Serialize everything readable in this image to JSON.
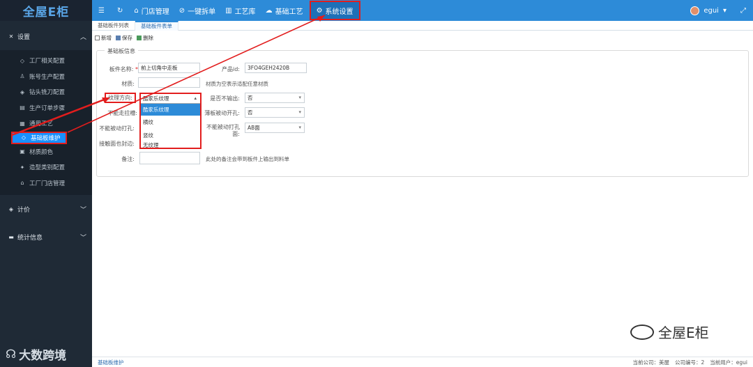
{
  "app": {
    "logo": "全屋E柜"
  },
  "topbar": {
    "menu_icon": "menu-icon",
    "refresh_icon": "refresh-icon",
    "nav": [
      "门店管理",
      "一键拆单",
      "工艺库",
      "基础工艺",
      "系统设置"
    ],
    "user": "egui"
  },
  "sidebar": {
    "groups": [
      {
        "label": "设置",
        "expanded": true
      },
      {
        "label": "计价",
        "expanded": false
      },
      {
        "label": "统计信息",
        "expanded": false
      }
    ],
    "items": [
      "工厂相关配置",
      "账号生产配置",
      "钻头铣刀配置",
      "生产订单步骤",
      "通用工艺",
      "基础板维护",
      "材质颜色",
      "造型类别配置",
      "工厂门店管理"
    ],
    "active_index": 5
  },
  "tabs": [
    "基础板件列表",
    "基础板件表单"
  ],
  "toolbar": {
    "new": "新增",
    "save": "保存",
    "delete": "删除"
  },
  "form": {
    "legend": "基础板信息",
    "name_label": "板件名称:",
    "name_required": "*",
    "name_value": "前上切角中走板",
    "product_id_label": "产品id:",
    "product_id_value": "3FO4GEH2420B",
    "material_label": "材质:",
    "material_hint": "材质为空表示适配任意材质",
    "grain_label": "纹理方向:",
    "grain_value": "酷家乐纹理",
    "no_output_label": "是否不输出:",
    "no_output_value": "否",
    "no_groove_label": "不能走拉槽:",
    "thin_label": "薄板被动开孔:",
    "thin_value": "否",
    "no_passive_label": "不能被动打孔:",
    "passive_face_label": "不能被动打孔面:",
    "passive_face_value": "AB面",
    "contact_label": "接触面也封边:",
    "remark_label": "备注:",
    "remark_hint": "此处的备注会带到板件上输出到料单"
  },
  "dropdown": {
    "options": [
      "酷家乐纹理",
      "横纹",
      "竖纹",
      "无纹理"
    ],
    "selected": 0
  },
  "footer": {
    "breadcrumb": "基础板维护",
    "company": "当前公司：美屋",
    "company_no": "公司编号：2",
    "user": "当前用户：egui"
  },
  "watermark": {
    "left": "大数跨境",
    "right": "全屋E柜"
  },
  "colors": {
    "topbar": "#2d8bd8",
    "sidebar": "#1f2a36",
    "active": "#1890ff",
    "highlight": "#e21d1d"
  }
}
